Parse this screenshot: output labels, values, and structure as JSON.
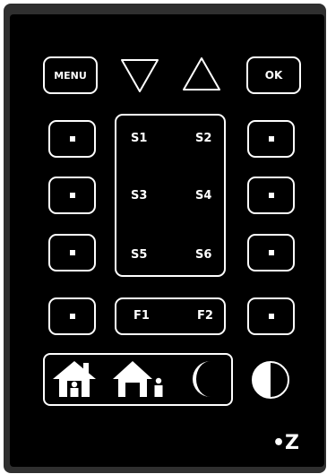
{
  "top_row": {
    "menu_label": "MENU",
    "ok_label": "OK",
    "down_icon": "triangle-down-icon",
    "up_icon": "triangle-up-icon"
  },
  "scenes": {
    "s1": "S1",
    "s2": "S2",
    "s3": "S3",
    "s4": "S4",
    "s5": "S5",
    "s6": "S6"
  },
  "functions": {
    "f1": "F1",
    "f2": "F2"
  },
  "modes": {
    "icons": [
      "home-icon",
      "home-away-icon",
      "moon-icon"
    ],
    "contrast_icon": "half-circle-icon"
  },
  "brand": {
    "logo": "•Z"
  },
  "colors": {
    "panel": "#000000",
    "bezel": "#2f2f2f",
    "foreground": "#ffffff"
  }
}
